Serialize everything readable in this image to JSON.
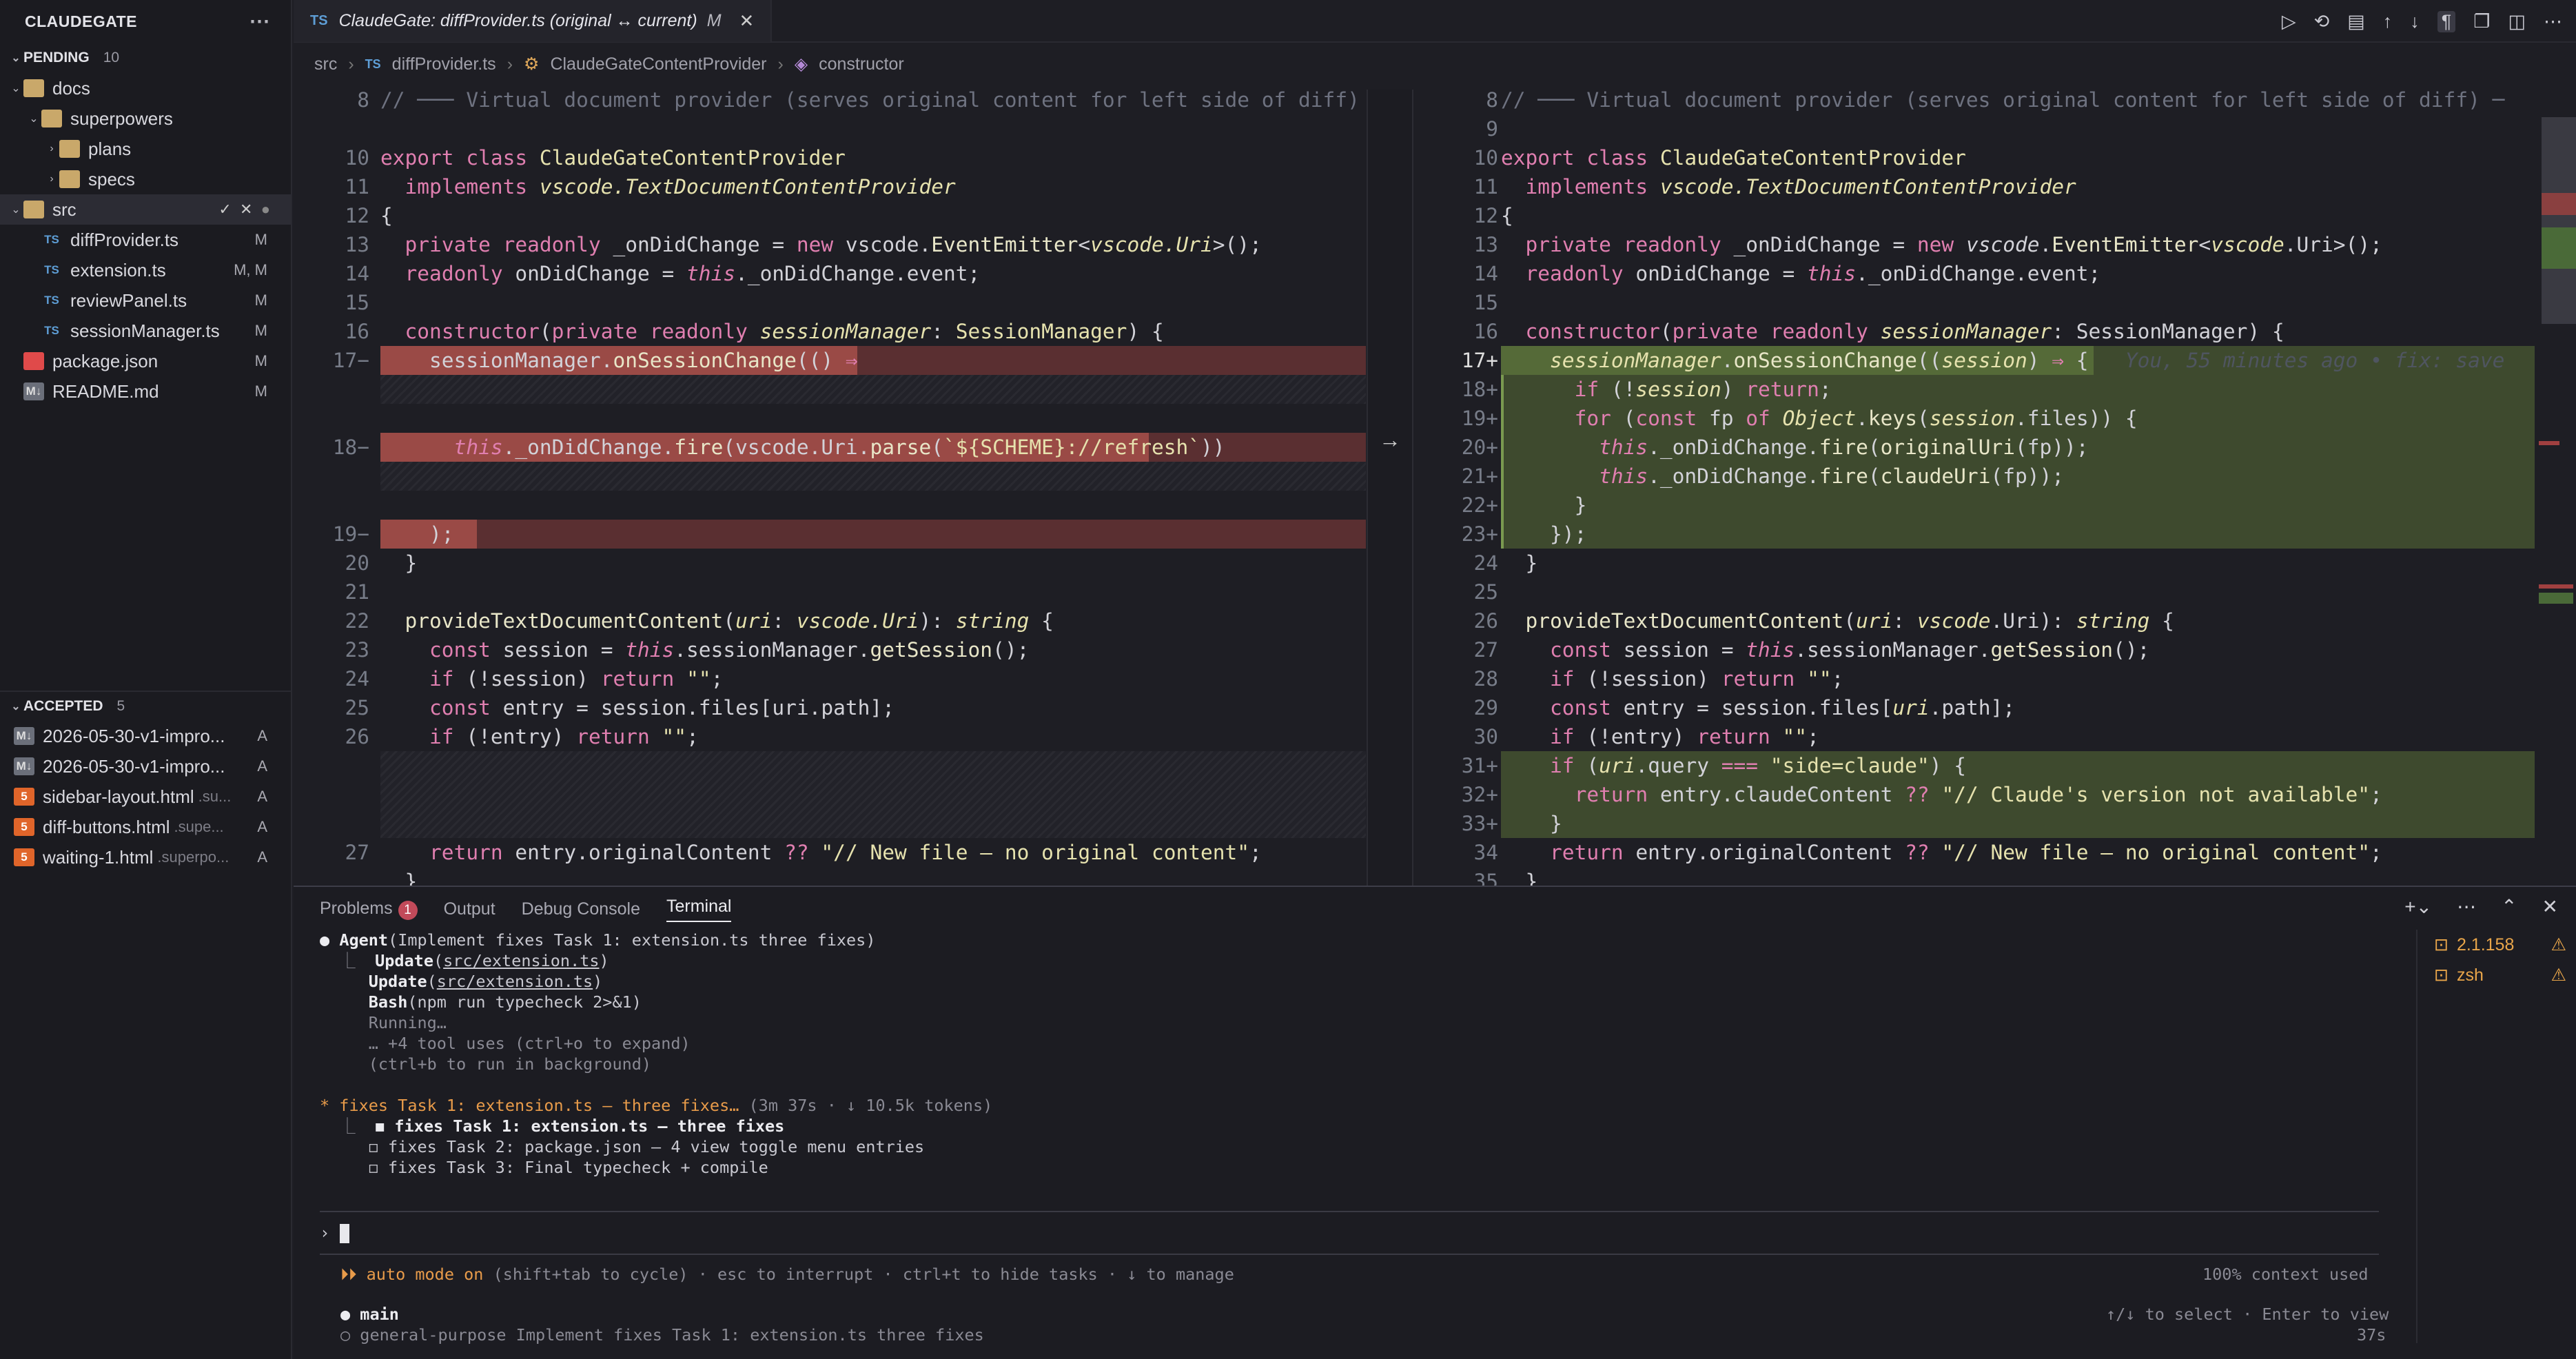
{
  "sidebar": {
    "title": "CLAUDEGATE",
    "pending": {
      "label": "PENDING",
      "count": "10"
    },
    "tree": [
      {
        "name": "docs",
        "indent": 1,
        "kind": "folder",
        "chev": "⌄"
      },
      {
        "name": "superpowers",
        "indent": 2,
        "kind": "folder",
        "chev": "⌄"
      },
      {
        "name": "plans",
        "indent": 3,
        "kind": "folder",
        "chev": "›"
      },
      {
        "name": "specs",
        "indent": 3,
        "kind": "folder",
        "chev": "›"
      },
      {
        "name": "src",
        "indent": 1,
        "kind": "folder",
        "chev": "⌄",
        "selected": true
      },
      {
        "name": "diffProvider.ts",
        "indent": 2,
        "kind": "ts",
        "status": "M"
      },
      {
        "name": "extension.ts",
        "indent": 2,
        "kind": "ts",
        "status": "M, M"
      },
      {
        "name": "reviewPanel.ts",
        "indent": 2,
        "kind": "ts",
        "status": "M"
      },
      {
        "name": "sessionManager.ts",
        "indent": 2,
        "kind": "ts",
        "status": "M"
      },
      {
        "name": "package.json",
        "indent": 1,
        "kind": "json",
        "status": "M"
      },
      {
        "name": "README.md",
        "indent": 1,
        "kind": "md",
        "status": "M"
      }
    ],
    "accepted": {
      "label": "ACCEPTED",
      "count": "5"
    },
    "accepted_items": [
      {
        "name": "2026-05-30-v1-impro...",
        "dim": "",
        "status": "A",
        "kind": "md"
      },
      {
        "name": "2026-05-30-v1-impro...",
        "dim": "",
        "status": "A",
        "kind": "md"
      },
      {
        "name": "sidebar-layout.html",
        "dim": ".su...",
        "status": "A",
        "kind": "html"
      },
      {
        "name": "diff-buttons.html",
        "dim": ".supe...",
        "status": "A",
        "kind": "html"
      },
      {
        "name": "waiting-1.html",
        "dim": ".superpo...",
        "status": "A",
        "kind": "html"
      }
    ]
  },
  "tab": {
    "lang": "TS",
    "title": "ClaudeGate: diffProvider.ts (original ↔ current)",
    "mod": "M"
  },
  "breadcrumb": {
    "a": "src",
    "b": "diffProvider.ts",
    "c": "ClaudeGateContentProvider",
    "d": "constructor"
  },
  "left_lines": [
    "8",
    "10",
    "11",
    "12",
    "13",
    "14",
    "15",
    "16",
    "17",
    "18",
    "19",
    "20",
    "21",
    "22",
    "23",
    "24",
    "25",
    "26",
    "27"
  ],
  "right_lines": [
    "8",
    "9",
    "10",
    "11",
    "12",
    "13",
    "14",
    "15",
    "16",
    "17",
    "18",
    "19",
    "20",
    "21",
    "22",
    "23",
    "24",
    "25",
    "26",
    "27",
    "28",
    "29",
    "30",
    "31",
    "32",
    "33",
    "34",
    "35"
  ],
  "blame": "You, 55 minutes ago • fix: save",
  "panel": {
    "tabs": [
      "Problems",
      "Output",
      "Debug Console",
      "Terminal"
    ],
    "problems_count": "1",
    "terminals": [
      "2.1.158",
      "zsh"
    ],
    "footer_left": "⏵⏵ auto mode on",
    "footer_hint": "(shift+tab to cycle) · esc to interrupt · ctrl+t to hide tasks · ↓ to manage",
    "context": "100% context used",
    "branch": "main",
    "agent_line": "○ general-purpose  Implement fixes Task 1: extension.ts three fixes",
    "select_hint": "↑/↓ to select · Enter to view",
    "elapsed": "37s"
  }
}
